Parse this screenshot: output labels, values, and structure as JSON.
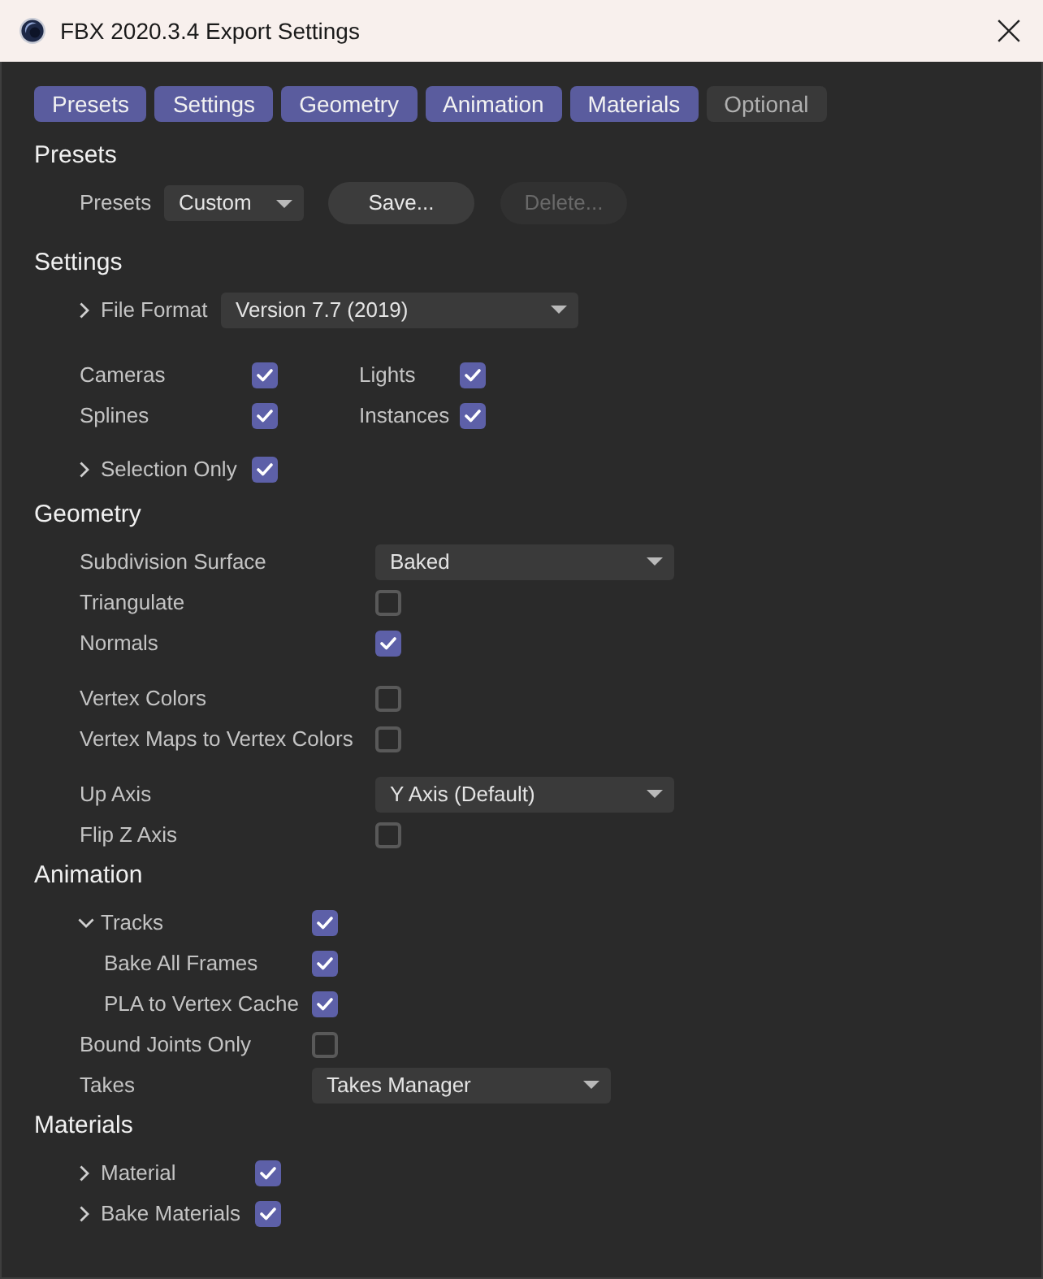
{
  "window": {
    "title": "FBX 2020.3.4 Export Settings"
  },
  "tabs": [
    {
      "label": "Presets",
      "selected": true
    },
    {
      "label": "Settings",
      "selected": true
    },
    {
      "label": "Geometry",
      "selected": true
    },
    {
      "label": "Animation",
      "selected": true
    },
    {
      "label": "Materials",
      "selected": true
    },
    {
      "label": "Optional",
      "selected": false
    }
  ],
  "sections": [
    {
      "title": "Presets",
      "groups": [
        {
          "rows": [
            {
              "kind": "preset",
              "label": "Presets",
              "value": "Custom",
              "buttons": [
                {
                  "label": "Save...",
                  "disabled": false
                },
                {
                  "label": "Delete...",
                  "disabled": true
                }
              ]
            }
          ]
        }
      ]
    },
    {
      "title": "Settings",
      "groups": [
        {
          "rows": [
            {
              "kind": "dropdown",
              "label": "File Format",
              "expanded": false,
              "value": "Version 7.7 (2019)"
            }
          ]
        },
        {
          "rows": [
            {
              "kind": "pair",
              "items": [
                {
                  "label": "Cameras",
                  "checked": true
                },
                {
                  "label": "Lights",
                  "checked": true
                }
              ]
            },
            {
              "kind": "pair",
              "items": [
                {
                  "label": "Splines",
                  "checked": true
                },
                {
                  "label": "Instances",
                  "checked": true
                }
              ]
            }
          ]
        },
        {
          "rows": [
            {
              "kind": "checkbox",
              "label": "Selection Only",
              "expanded": false,
              "checked": true
            }
          ]
        }
      ]
    },
    {
      "title": "Geometry",
      "groups": [
        {
          "rows": [
            {
              "kind": "dropdown",
              "label": "Subdivision Surface",
              "value": "Baked"
            },
            {
              "kind": "checkbox",
              "label": "Triangulate",
              "checked": false
            },
            {
              "kind": "checkbox",
              "label": "Normals",
              "checked": true
            }
          ]
        },
        {
          "rows": [
            {
              "kind": "checkbox",
              "label": "Vertex Colors",
              "checked": false
            },
            {
              "kind": "checkbox",
              "label": "Vertex Maps to Vertex Colors",
              "checked": false
            }
          ]
        },
        {
          "rows": [
            {
              "kind": "dropdown",
              "label": "Up Axis",
              "value": "Y Axis (Default)"
            },
            {
              "kind": "checkbox",
              "label": "Flip Z Axis",
              "checked": false
            }
          ]
        }
      ]
    },
    {
      "title": "Animation",
      "groups": [
        {
          "rows": [
            {
              "kind": "checkbox",
              "label": "Tracks",
              "expanded": true,
              "checked": true,
              "children": [
                {
                  "kind": "checkbox",
                  "label": "Bake All Frames",
                  "checked": true
                },
                {
                  "kind": "checkbox",
                  "label": "PLA to Vertex Cache",
                  "checked": true
                }
              ]
            },
            {
              "kind": "checkbox",
              "label": "Bound Joints Only",
              "checked": false
            },
            {
              "kind": "dropdown",
              "label": "Takes",
              "value": "Takes Manager"
            }
          ]
        }
      ]
    },
    {
      "title": "Materials",
      "groups": [
        {
          "rows": [
            {
              "kind": "checkbox",
              "label": "Material",
              "expanded": false,
              "checked": true
            },
            {
              "kind": "checkbox",
              "label": "Bake Materials",
              "expanded": false,
              "checked": true
            }
          ]
        }
      ]
    }
  ]
}
